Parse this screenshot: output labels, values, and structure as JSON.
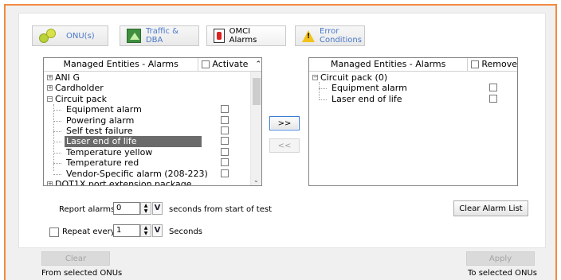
{
  "tabs": [
    {
      "label": "ONU(s)",
      "icon": "onu-icon"
    },
    {
      "label": "Traffic & DBA",
      "icon": "traffic-icon"
    },
    {
      "label": "OMCI Alarms",
      "icon": "omci-alarm-icon"
    },
    {
      "label": "Error Conditions",
      "icon": "warning-icon"
    }
  ],
  "left_list": {
    "header_col1": "Managed Entities - Alarms",
    "header_col2": "Activate",
    "items": [
      {
        "label": "ANI G",
        "expander": "+"
      },
      {
        "label": "Cardholder",
        "expander": "+"
      },
      {
        "label": "Circuit pack",
        "expander": "−"
      },
      {
        "label": "Equipment alarm"
      },
      {
        "label": "Powering alarm"
      },
      {
        "label": "Self test failure"
      },
      {
        "label": "Laser end of life"
      },
      {
        "label": "Temperature yellow"
      },
      {
        "label": "Temperature red"
      },
      {
        "label": "Vendor-Specific alarm (208-223)"
      },
      {
        "label": "DOT1X port extension package",
        "expander": "+"
      }
    ]
  },
  "right_list": {
    "header_col1": "Managed Entities - Alarms",
    "header_col2": "Remove",
    "items": [
      {
        "label": "Circuit pack (0)",
        "expander": "−"
      },
      {
        "label": "Equipment alarm"
      },
      {
        "label": "Laser end of life"
      }
    ]
  },
  "buttons": {
    "add": ">>",
    "remove": "<<",
    "clear_alarm_list": "Clear Alarm List",
    "clear": "Clear",
    "apply": "Apply"
  },
  "report": {
    "label": "Report alarms",
    "value": "0",
    "suffix": "seconds from start of test",
    "v_label": "V"
  },
  "repeat": {
    "label": "Repeat every",
    "value": "1",
    "suffix": "Seconds",
    "v_label": "V"
  },
  "footer": {
    "left": "From selected ONUs",
    "right": "To selected ONUs"
  },
  "colors": {
    "accent_border": "#f28b40",
    "selection": "#6b6b6b",
    "link_text": "#4a78c8"
  }
}
